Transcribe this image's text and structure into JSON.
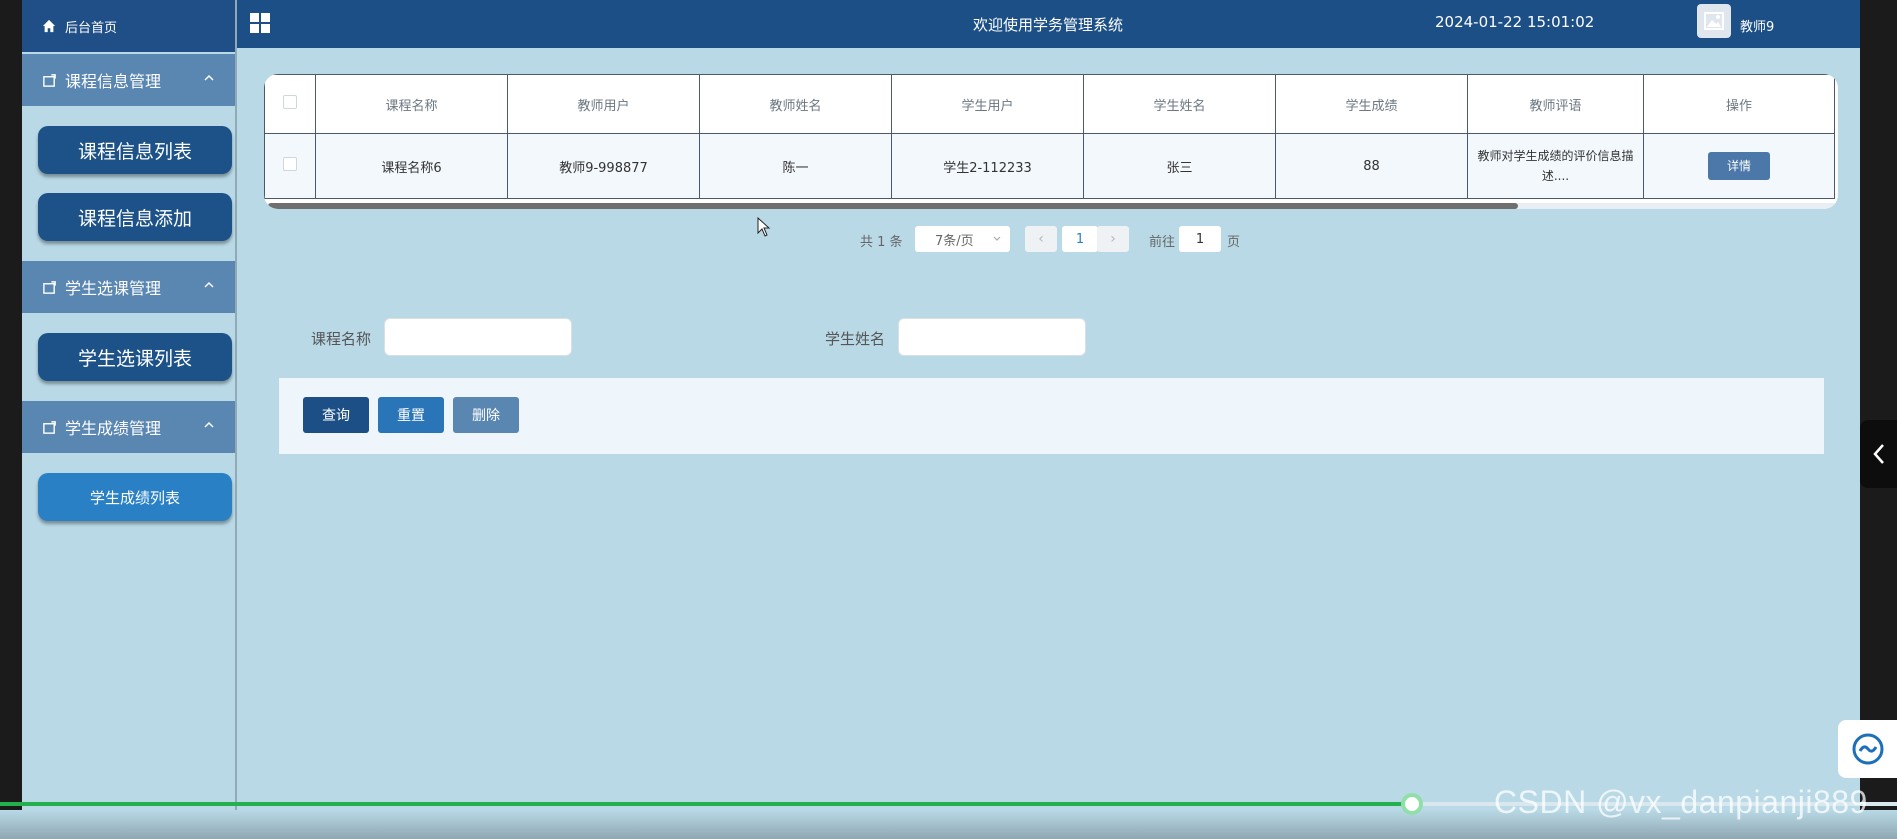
{
  "sidebar": {
    "home": "后台首页",
    "groups": [
      {
        "label": "课程信息管理",
        "items": [
          "课程信息列表",
          "课程信息添加"
        ]
      },
      {
        "label": "学生选课管理",
        "items": [
          "学生选课列表"
        ]
      },
      {
        "label": "学生成绩管理",
        "items": [
          "学生成绩列表"
        ]
      }
    ]
  },
  "topbar": {
    "title": "欢迎使用学务管理系统",
    "datetime": "2024-01-22 15:01:02",
    "user": "教师9"
  },
  "table": {
    "headers": [
      "课程名称",
      "教师用户",
      "教师姓名",
      "学生用户",
      "学生姓名",
      "学生成绩",
      "教师评语",
      "操作"
    ],
    "rows": [
      {
        "course": "课程名称6",
        "teacher_user": "教师9-998877",
        "teacher_name": "陈一",
        "student_user": "学生2-112233",
        "student_name": "张三",
        "score": "88",
        "comment": "教师对学生成绩的评价信息描述....",
        "action": "详情"
      }
    ]
  },
  "pagination": {
    "total": "共 1 条",
    "page_size": "7条/页",
    "current_page": "1",
    "goto_label": "前往",
    "goto_value": "1",
    "page_suffix": "页"
  },
  "search": {
    "course_label": "课程名称",
    "student_label": "学生姓名",
    "buttons": {
      "query": "查询",
      "reset": "重置",
      "delete": "删除"
    }
  },
  "watermark": "CSDN @vx_danpianji889",
  "colors": {
    "topbar": "#1c4f86",
    "sidebar_group": "#5a86b2",
    "sidebar_button": "#1c5288",
    "sidebar_button_active": "#2a80c4",
    "background": "#b9d9e6",
    "progress": "#22b14c"
  },
  "video_progress": 0.745
}
